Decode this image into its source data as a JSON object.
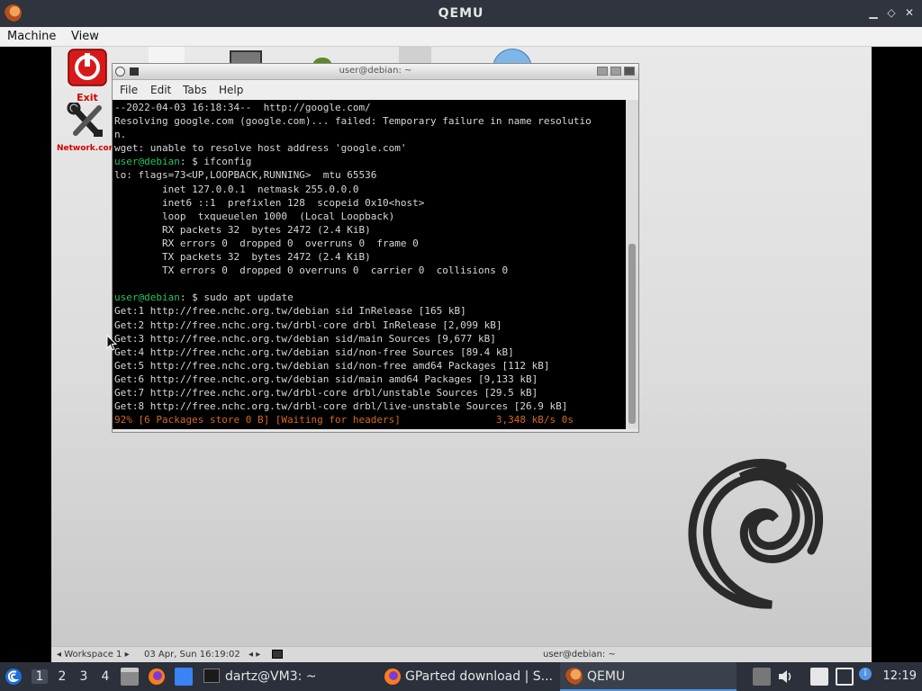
{
  "window": {
    "title": "QEMU",
    "controls": {
      "minimize": "▁",
      "restore": "◇",
      "close": "✕"
    }
  },
  "menubar": {
    "items": [
      "Machine",
      "View"
    ]
  },
  "desktop": {
    "icons": [
      {
        "label": "Exit"
      },
      {
        "label": "Network.conf"
      }
    ]
  },
  "terminal": {
    "title": "user@debian: ~",
    "menu": [
      "File",
      "Edit",
      "Tabs",
      "Help"
    ],
    "lines": [
      {
        "text": "--2022-04-03 16:18:34--  http://google.com/"
      },
      {
        "text": "Resolving google.com (google.com)... failed: Temporary failure in name resolutio"
      },
      {
        "text": "n."
      },
      {
        "text": "wget: unable to resolve host address 'google.com'"
      },
      {
        "prompt": "user@debian",
        "text": ": $ ifconfig"
      },
      {
        "text": "lo: flags=73<UP,LOOPBACK,RUNNING>  mtu 65536"
      },
      {
        "text": "        inet 127.0.0.1  netmask 255.0.0.0"
      },
      {
        "text": "        inet6 ::1  prefixlen 128  scopeid 0x10<host>"
      },
      {
        "text": "        loop  txqueuelen 1000  (Local Loopback)"
      },
      {
        "text": "        RX packets 32  bytes 2472 (2.4 KiB)"
      },
      {
        "text": "        RX errors 0  dropped 0  overruns 0  frame 0"
      },
      {
        "text": "        TX packets 32  bytes 2472 (2.4 KiB)"
      },
      {
        "text": "        TX errors 0  dropped 0 overruns 0  carrier 0  collisions 0"
      },
      {
        "text": ""
      },
      {
        "prompt": "user@debian",
        "text": ": $ sudo apt update"
      },
      {
        "text": "Get:1 http://free.nchc.org.tw/debian sid InRelease [165 kB]"
      },
      {
        "text": "Get:2 http://free.nchc.org.tw/drbl-core drbl InRelease [2,099 kB]"
      },
      {
        "text": "Get:3 http://free.nchc.org.tw/debian sid/main Sources [9,677 kB]"
      },
      {
        "text": "Get:4 http://free.nchc.org.tw/debian sid/non-free Sources [89.4 kB]"
      },
      {
        "text": "Get:5 http://free.nchc.org.tw/debian sid/non-free amd64 Packages [112 kB]"
      },
      {
        "text": "Get:6 http://free.nchc.org.tw/debian sid/main amd64 Packages [9,133 kB]"
      },
      {
        "text": "Get:7 http://free.nchc.org.tw/drbl-core drbl/unstable Sources [29.5 kB]"
      },
      {
        "text": "Get:8 http://free.nchc.org.tw/drbl-core drbl/live-unstable Sources [26.9 kB]"
      },
      {
        "status": true,
        "text": "92% [6 Packages store 0 B] [Waiting for headers]                3,348 kB/s 0s"
      }
    ]
  },
  "guest_panel": {
    "workspace": "◂ Workspace 1 ▸",
    "datetime": "03 Apr, Sun 16:19:02",
    "nav": "◂ ▸",
    "task": "user@debian: ~"
  },
  "taskbar": {
    "workspaces": [
      "1",
      "2",
      "3",
      "4"
    ],
    "tasks": [
      {
        "label": "dartz@VM3: ~"
      },
      {
        "label": "GParted download | S..."
      },
      {
        "label": "QEMU"
      }
    ],
    "clock": "12:19"
  },
  "colors": {
    "prompt": "#22c55e",
    "status": "#d66a1a",
    "exit_label": "#d40000",
    "taskbar": "#2b303b"
  }
}
